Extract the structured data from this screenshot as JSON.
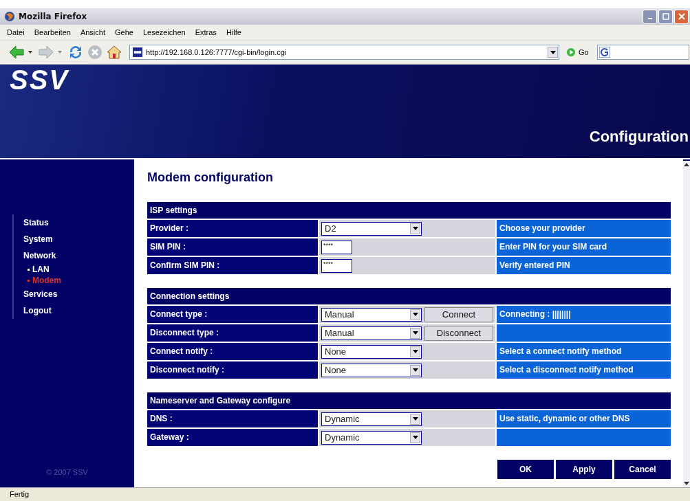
{
  "window": {
    "title": "Mozilla Firefox"
  },
  "menu": [
    "Datei",
    "Bearbeiten",
    "Ansicht",
    "Gehe",
    "Lesezeichen",
    "Extras",
    "Hilfe"
  ],
  "address": {
    "value": "http://192.168.0.126:7777/cgi-bin/login.cgi"
  },
  "go_button": "Go",
  "header": {
    "logo": "SSV",
    "title": "Configuration"
  },
  "sidebar": {
    "items": [
      {
        "label": "Status",
        "selected": false
      },
      {
        "label": "System",
        "selected": false
      },
      {
        "label": "Network",
        "selected": false,
        "children": [
          {
            "label": "LAN",
            "selected": false
          },
          {
            "label": "Modem",
            "selected": true
          }
        ]
      },
      {
        "label": "Services",
        "selected": false
      },
      {
        "label": "Logout",
        "selected": false
      }
    ],
    "copyright": "© 2007 SSV"
  },
  "page_title": "Modem configuration",
  "sections": [
    {
      "title": "ISP settings",
      "rows": [
        {
          "label": "Provider :",
          "kind": "select",
          "value": "D2",
          "description": "Choose your provider"
        },
        {
          "label": "SIM PIN :",
          "kind": "password",
          "value": "****",
          "description": "Enter PIN for your SIM card"
        },
        {
          "label": "Confirm SIM PIN :",
          "kind": "password",
          "value": "****",
          "description": "Verify entered PIN"
        }
      ]
    },
    {
      "title": "Connection settings",
      "rows": [
        {
          "label": "Connect type :",
          "kind": "select",
          "value": "Manual",
          "button": "Connect",
          "description": "Connecting : ||||||||"
        },
        {
          "label": "Disconnect type :",
          "kind": "select",
          "value": "Manual",
          "button": "Disconnect"
        },
        {
          "label": "Connect notify :",
          "kind": "select",
          "value": "None",
          "description": "Select a connect notify method"
        },
        {
          "label": "Disconnect notify :",
          "kind": "select",
          "value": "None",
          "description": "Select a disconnect notify method"
        }
      ]
    },
    {
      "title": "Nameserver and Gateway configure",
      "rows": [
        {
          "label": "DNS :",
          "kind": "select",
          "value": "Dynamic",
          "description": "Use static, dynamic or other DNS"
        },
        {
          "label": "Gateway :",
          "kind": "select",
          "value": "Dynamic"
        }
      ]
    }
  ],
  "buttons": [
    "OK",
    "Apply",
    "Cancel"
  ],
  "status_bar": "Fertig"
}
